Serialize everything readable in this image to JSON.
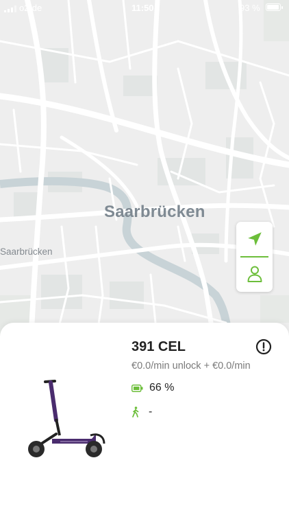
{
  "status_bar": {
    "carrier": "o2-de",
    "time": "11:50",
    "battery": "93 %"
  },
  "map": {
    "city_label": "Saarbrücken",
    "district_label": "Saarbrücken"
  },
  "vehicle": {
    "name": "391 CEL",
    "pricing": "€0.0/min unlock + €0.0/min",
    "battery": "66 %",
    "walk_time": "-"
  },
  "icons": {
    "locate": "navigation-arrow-icon",
    "profile": "user-icon",
    "info": "info-circle-icon",
    "battery": "battery-icon",
    "walk": "walking-person-icon"
  },
  "colors": {
    "accent": "#6cbe3a",
    "river": "#c8d3d7",
    "map_bg": "#eeeeee"
  }
}
